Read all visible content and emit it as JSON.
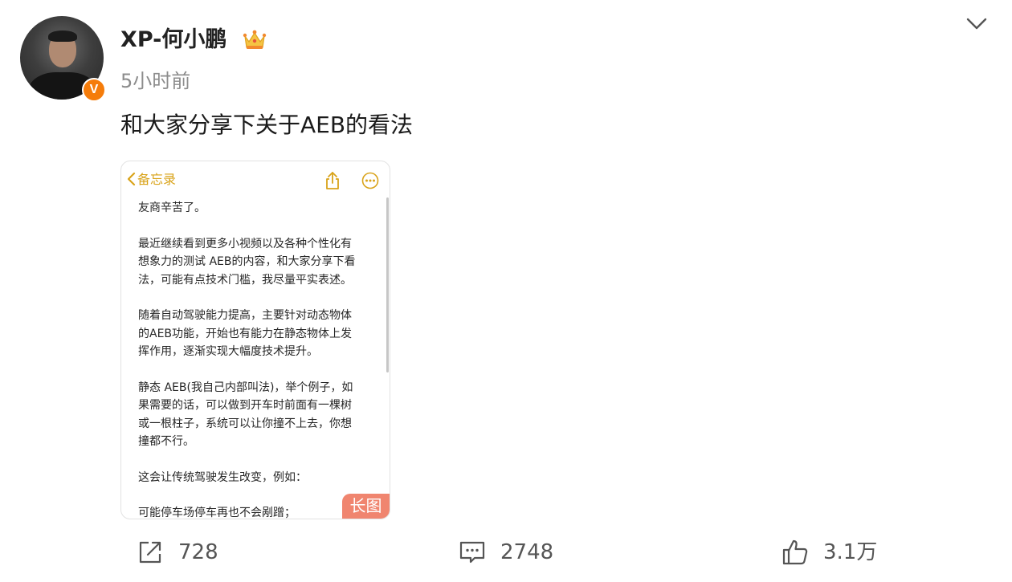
{
  "post": {
    "username": "XP-何小鹏",
    "timestamp": "5小时前",
    "verified_mark": "V",
    "text": "和大家分享下关于AEB的看法"
  },
  "memo": {
    "back_label": "备忘录",
    "accent_color": "#d9a31a",
    "paragraphs": [
      [
        "友商辛苦了。"
      ],
      [
        "最近继续看到更多小视频以及各种个性化有",
        "想象力的测试 AEB的内容，和大家分享下看",
        "法，可能有点技术门槛，我尽量平实表述。"
      ],
      [
        "随着自动驾驶能力提高，主要针对动态物体",
        "的AEB功能，开始也有能力在静态物体上发",
        "挥作用，逐渐实现大幅度技术提升。"
      ],
      [
        "静态 AEB(我自己内部叫法)，举个例子，如",
        "果需要的话，可以做到开车时前面有一棵树",
        "或一根柱子，系统可以让你撞不上去，你想",
        "撞都不行。"
      ],
      [
        "这会让传统驾驶发生改变，例如："
      ],
      [
        "可能停车场停车再也不会剐蹭；"
      ]
    ],
    "long_image_label": "长图"
  },
  "actions": {
    "repost_count": "728",
    "comment_count": "2748",
    "like_count": "3.1万"
  },
  "icons": {
    "crown": "crown-icon",
    "collapse": "chevron-down-icon",
    "share": "share-icon",
    "more": "more-icon",
    "repost": "repost-icon",
    "comment": "comment-icon",
    "like": "thumbs-up-icon"
  },
  "colors": {
    "verified_badge": "#f57c0a",
    "long_image_badge": "#f0856f",
    "timestamp": "#8c8c8c"
  }
}
